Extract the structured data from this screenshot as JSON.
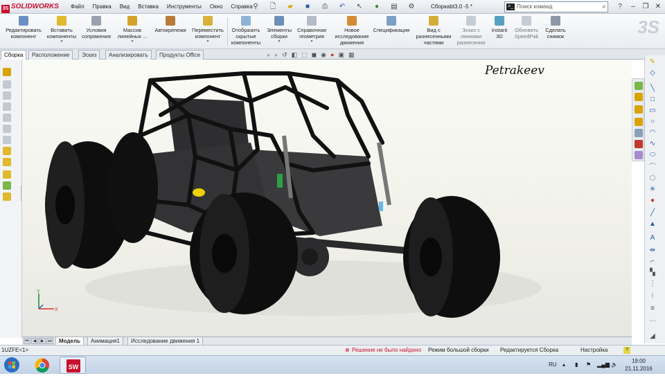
{
  "app": {
    "logo_text": "SOLIDWORKS",
    "doc_title": "Сборкаbt3.0 -5 *"
  },
  "menu": [
    "Файл",
    "Правка",
    "Вид",
    "Вставка",
    "Инструменты",
    "Окно",
    "Справка"
  ],
  "command_search": {
    "placeholder": "Поиск команд"
  },
  "ribbon": {
    "edit_component": "Редактировать компонент",
    "insert_components": "Вставить компоненты",
    "mate": "Условия сопряжения",
    "linear_pattern": "Массив линейных ...",
    "smart_fasteners": "Автокрепежи",
    "move_component": "Переместить компонент",
    "show_hidden": "Отобразить скрытые компоненты",
    "assembly_features": "Элементы сборки",
    "reference_geometry": "Справочная геометрия",
    "new_motion_study": "Новое исследование движения",
    "bom": "Спецификация",
    "exploded_view": "Вид с разнесенными частями",
    "explode_line_sketch": "Эскиз с линиями разнесения",
    "instant3d": "Instant 3D",
    "update_speedpak": "Обновить SpeedPak",
    "take_snapshot": "Сделать снимок"
  },
  "tabs": [
    "Сборка",
    "Расположение",
    "Эскиз",
    "Анализировать",
    "Продукты Office"
  ],
  "viewport": {
    "signature": "Petrakeev",
    "axis_x": "X",
    "axis_y": "Y"
  },
  "bottom_tabs": [
    "Модель",
    "Анимация1",
    "Исследование движения 1"
  ],
  "status": {
    "left": "1UZFE<1>",
    "error": "Решение не было найдено",
    "mode": "Режим большой сборки",
    "editing": "Редактируется Сборка",
    "settings": "Настройка"
  },
  "taskbar": {
    "lang": "RU",
    "time": "19:00",
    "date": "21.11.2016"
  },
  "colors": {
    "brand": "#c8102e",
    "ribbon_bg": "#eef1f4",
    "viewport_bg": "#f3f3ee"
  }
}
